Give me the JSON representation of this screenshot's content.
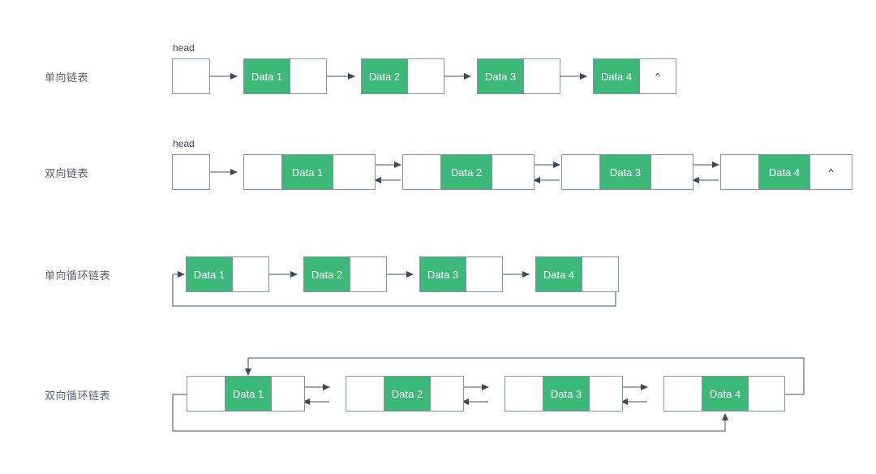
{
  "diagram": {
    "title": "linked-list-types-diagram",
    "colors": {
      "data_fill": "#3cb878",
      "data_text": "#ffffff",
      "cell_border": "#8794a5",
      "arrow": "#64748b",
      "label_text": "#5a6370",
      "background": "#ffffff"
    },
    "null_symbol": "^",
    "head_label": "head",
    "rows": [
      {
        "id": "singly-linked-list",
        "label": "单向链表",
        "has_head": true,
        "head_label": "head",
        "nodes": [
          {
            "data": "Data 1",
            "pointer": ""
          },
          {
            "data": "Data 2",
            "pointer": ""
          },
          {
            "data": "Data 3",
            "pointer": ""
          },
          {
            "data": "Data 4",
            "pointer": "^"
          }
        ]
      },
      {
        "id": "doubly-linked-list",
        "label": "双向链表",
        "has_head": true,
        "head_label": "head",
        "nodes": [
          {
            "prev": "",
            "data": "Data 1",
            "next": ""
          },
          {
            "prev": "",
            "data": "Data 2",
            "next": ""
          },
          {
            "prev": "",
            "data": "Data 3",
            "next": ""
          },
          {
            "prev": "",
            "data": "Data 4",
            "next": "^"
          }
        ]
      },
      {
        "id": "singly-circular-linked-list",
        "label": "单向循环链表",
        "has_head": false,
        "nodes": [
          {
            "data": "Data 1",
            "pointer": ""
          },
          {
            "data": "Data 2",
            "pointer": ""
          },
          {
            "data": "Data 3",
            "pointer": ""
          },
          {
            "data": "Data 4",
            "pointer": ""
          }
        ]
      },
      {
        "id": "doubly-circular-linked-list",
        "label": "双向循环链表",
        "has_head": false,
        "nodes": [
          {
            "prev": "",
            "data": "Data 1",
            "next": ""
          },
          {
            "prev": "",
            "data": "Data 2",
            "next": ""
          },
          {
            "prev": "",
            "data": "Data 3",
            "next": ""
          },
          {
            "prev": "",
            "data": "Data 4",
            "next": ""
          }
        ]
      }
    ]
  }
}
